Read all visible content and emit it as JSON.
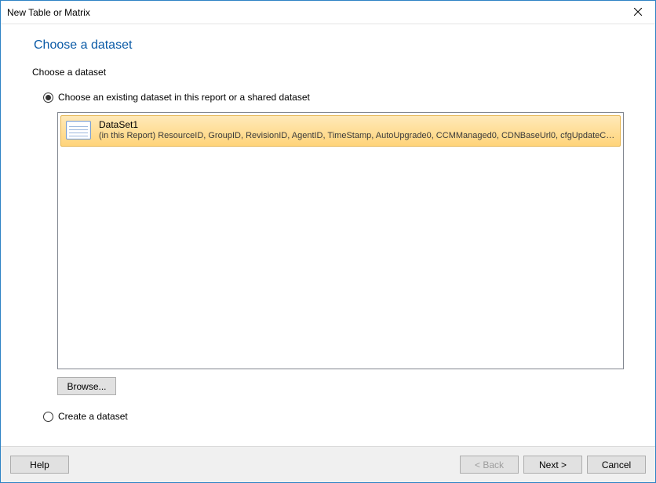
{
  "window": {
    "title": "New Table or Matrix"
  },
  "page": {
    "heading": "Choose a dataset",
    "subheading": "Choose a dataset"
  },
  "options": {
    "existing_label": "Choose an existing dataset in this report or a shared dataset",
    "create_label": "Create a dataset",
    "selected": "existing"
  },
  "datasets": {
    "selected_index": 0,
    "items": [
      {
        "name": "DataSet1",
        "detail": "(in this Report) ResourceID, GroupID, RevisionID, AgentID, TimeStamp, AutoUpgrade0, CCMManaged0, CDNBaseUrl0, cfgUpdateChan…"
      }
    ]
  },
  "buttons": {
    "browse": "Browse...",
    "help": "Help",
    "back": "< Back",
    "next": "Next >",
    "cancel": "Cancel"
  }
}
